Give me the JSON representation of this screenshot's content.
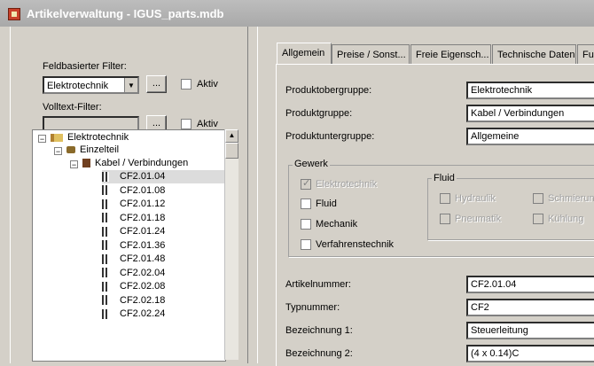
{
  "window": {
    "title": "Artikelverwaltung - IGUS_parts.mdb",
    "icon": "app-icon"
  },
  "filter": {
    "field_label": "Feldbasierter Filter:",
    "field_value": "Elektrotechnik",
    "browse_label": "...",
    "active_label": "Aktiv",
    "fulltext_label": "Volltext-Filter:",
    "fulltext_value": "",
    "fulltext_browse_label": "...",
    "fulltext_active_label": "Aktiv"
  },
  "tree": {
    "root": "Elektrotechnik",
    "level1": "Einzelteil",
    "level2": "Kabel / Verbindungen",
    "items": [
      "CF2.01.04",
      "CF2.01.08",
      "CF2.01.12",
      "CF2.01.18",
      "CF2.01.24",
      "CF2.01.36",
      "CF2.01.48",
      "CF2.02.04",
      "CF2.02.08",
      "CF2.02.18",
      "CF2.02.24"
    ]
  },
  "tabs": [
    "Allgemein",
    "Preise / Sonst...",
    "Freie Eigensch...",
    "Technische Daten",
    "Fu"
  ],
  "form": {
    "obergruppe_label": "Produktobergruppe:",
    "obergruppe_value": "Elektrotechnik",
    "gruppe_label": "Produktgruppe:",
    "gruppe_value": "Kabel / Verbindungen",
    "untergruppe_label": "Produktuntergruppe:",
    "untergruppe_value": "Allgemeine",
    "gewerk_title": "Gewerk",
    "gewerk": {
      "elektrotechnik": "Elektrotechnik",
      "fluid": "Fluid",
      "mechanik": "Mechanik",
      "verfahrenstechnik": "Verfahrenstechnik"
    },
    "fluid_title": "Fluid",
    "fluid": {
      "hydraulik": "Hydraulik",
      "schmierung": "Schmierung",
      "pneumatik": "Pneumatik",
      "kuehlung": "Kühlung"
    },
    "artikelnummer_label": "Artikelnummer:",
    "artikelnummer_value": "CF2.01.04",
    "typnummer_label": "Typnummer:",
    "typnummer_value": "CF2",
    "bezeichnung1_label": "Bezeichnung 1:",
    "bezeichnung1_value": "Steuerleitung",
    "bezeichnung2_label": "Bezeichnung 2:",
    "bezeichnung2_value": "(4 x 0.14)C"
  }
}
